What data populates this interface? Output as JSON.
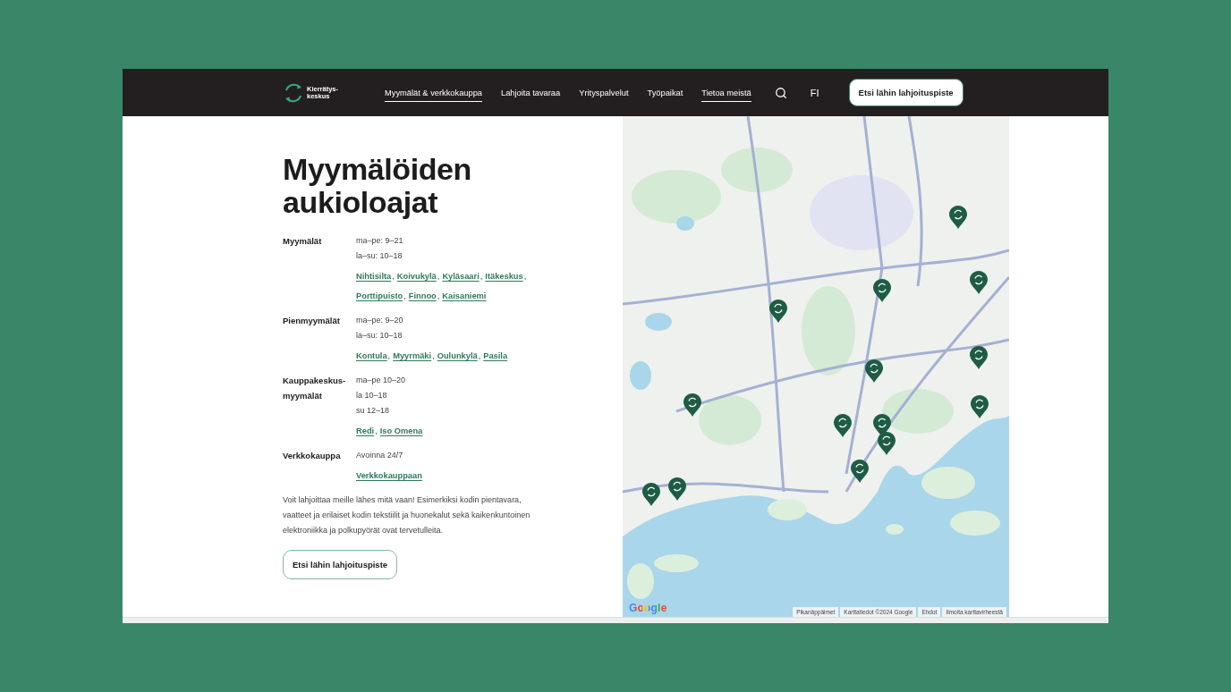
{
  "header": {
    "logo": {
      "text": "Kierrätys-keskus"
    },
    "nav": [
      {
        "label": "Myymälät & verkkokauppa",
        "selected": true
      },
      {
        "label": "Lahjoita tavaraa",
        "selected": false
      },
      {
        "label": "Yrityspalvelut",
        "selected": false
      },
      {
        "label": "Työpaikat",
        "selected": false
      },
      {
        "label": "Tietoa meistä",
        "selected": true
      }
    ],
    "language": "FI",
    "cta": "Etsi lähin lahjoituspiste"
  },
  "main": {
    "title": "Myymälöiden aukioloajat",
    "link_separator": ",",
    "groups": [
      {
        "label": "Myymälät",
        "hours": [
          "ma–pe: 9–21",
          "la–su: 10–18"
        ],
        "links": [
          "Nihtisilta",
          "Koivukylä",
          "Kyläsaari",
          "Itäkeskus",
          "Porttipuisto",
          "Finnoo",
          "Kaisaniemi"
        ]
      },
      {
        "label": "Pienmyymälät",
        "hours": [
          "ma–pe: 9–20",
          "la–su: 10–18"
        ],
        "links": [
          "Kontula",
          "Myyrmäki",
          "Oulunkylä",
          "Pasila"
        ]
      },
      {
        "label": "Kauppakeskus-myymälät",
        "hours": [
          "ma–pe 10–20",
          "la 10–18",
          "su 12–18"
        ],
        "links": [
          "Redi",
          "Iso Omena"
        ]
      },
      {
        "label": "Verkkokauppa",
        "hours": [
          "Avoinna 24/7"
        ],
        "links": [
          "Verkkokauppaan"
        ]
      }
    ],
    "intro": "Voit lahjoittaa meille lähes mitä vaan! Esimerkiksi kodin pientavara, vaatteet ja erilaiset kodin tekstiilit ja huonekalut sekä kaikenkuntoinen elektroniikka ja polkupyörät ovat tervetulleita.",
    "button": "Etsi lähin lahjoituspiste"
  },
  "map": {
    "logo": "Google",
    "attribution": [
      "Pikanäppäimet",
      "Karttatiedot ©2024 Google",
      "Ehdot",
      "Ilmoita karttavirheestä"
    ]
  }
}
